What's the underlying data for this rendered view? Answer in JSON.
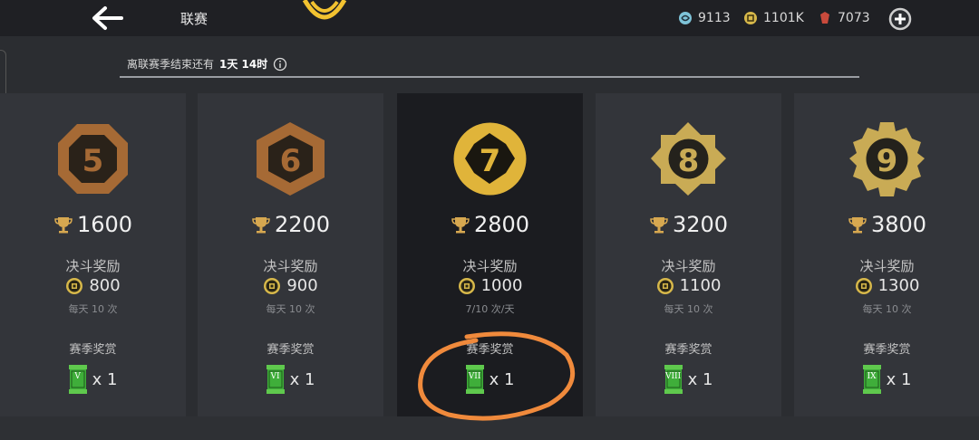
{
  "header": {
    "title": "联赛",
    "currencies": [
      {
        "icon": "gem-swirl-icon",
        "value": "9113",
        "color": "#7ec3d8"
      },
      {
        "icon": "coin-icon",
        "value": "1101K",
        "color": "#d7b84a"
      },
      {
        "icon": "red-crystal-icon",
        "value": "7073",
        "color": "#c94a3c"
      }
    ]
  },
  "season": {
    "countdown_label": "离联赛季结束还有",
    "countdown_value": "1天 14时"
  },
  "tiers": [
    {
      "level": "5",
      "trophies": "1600",
      "duel_label": "决斗奖励",
      "duel_amount": "800",
      "duel_note": "每天 10 次",
      "season_label": "赛季奖赏",
      "chest_numeral": "V",
      "chest_qty": "x 1",
      "current": false
    },
    {
      "level": "6",
      "trophies": "2200",
      "duel_label": "决斗奖励",
      "duel_amount": "900",
      "duel_note": "每天 10 次",
      "season_label": "赛季奖赏",
      "chest_numeral": "VI",
      "chest_qty": "x 1",
      "current": false
    },
    {
      "level": "7",
      "trophies": "2800",
      "duel_label": "决斗奖励",
      "duel_amount": "1000",
      "duel_note": "7/10 次/天",
      "season_label": "赛季奖赏",
      "chest_numeral": "VII",
      "chest_qty": "x 1",
      "current": true
    },
    {
      "level": "8",
      "trophies": "3200",
      "duel_label": "决斗奖励",
      "duel_amount": "1100",
      "duel_note": "每天 10 次",
      "season_label": "赛季奖赏",
      "chest_numeral": "VIII",
      "chest_qty": "x 1",
      "current": false
    },
    {
      "level": "9",
      "trophies": "3800",
      "duel_label": "决斗奖励",
      "duel_amount": "1300",
      "duel_note": "每天 10 次",
      "season_label": "赛季奖赏",
      "chest_numeral": "IX",
      "chest_qty": "x 1",
      "current": false
    }
  ],
  "colors": {
    "bronze": "#a66a35",
    "gold": "#e0b43a",
    "pale_gold": "#c9ab55",
    "chest_green": "#3fae3a",
    "annotation": "#f08a3c"
  }
}
